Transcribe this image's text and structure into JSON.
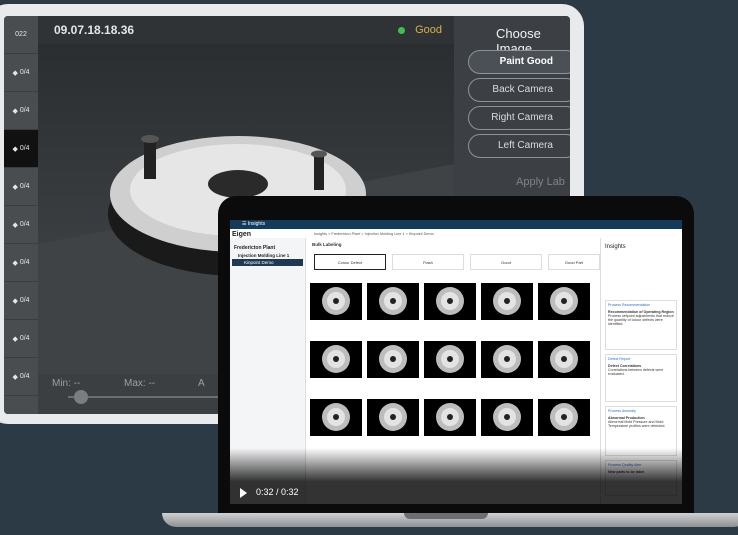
{
  "tablet": {
    "timestamp": "09.07.18.18.36",
    "status": "Good",
    "year_stub": "022",
    "row_label": "0/4",
    "choose_title": "Choose Image",
    "buttons": [
      "Paint Good",
      "Back Camera",
      "Right Camera",
      "Left Camera"
    ],
    "apply_label": "Apply Lab",
    "min_label": "Min: --",
    "max_label": "Max: --",
    "a_label": "A"
  },
  "laptop": {
    "app_title": "Insights",
    "brand": "Eigen",
    "breadcrumb": "Insights > Fredericton Plant > Injection Molding Line 1 > Kinpoint Demo",
    "nav": [
      "Fredericton Plant",
      "Injection Molding Line 1",
      "Kinpoint Demo"
    ],
    "bulk_title": "Bulk Labeling",
    "tabs": [
      "Colour Defect",
      "Flash",
      "Good",
      "Good Part"
    ],
    "insights_title": "Insights",
    "cards": [
      {
        "h": "Process Recommendation",
        "b": "Recommendation of Operating Region",
        "t": "Process setpoint adjustments that reduce the quantity of colour defects were identified."
      },
      {
        "h": "Defect Report",
        "b": "Defect Correlations",
        "t": "Correlations between defects were evaluated."
      },
      {
        "h": "Process Anomaly",
        "b": "Abnormal Production",
        "t": "Abnormal Mold Pressure and Mold Temperature profiles were detected."
      },
      {
        "h": "Process Quality Alert",
        "b": "New parts to be label",
        "t": ""
      }
    ],
    "video_time": "0:32 / 0:32"
  }
}
